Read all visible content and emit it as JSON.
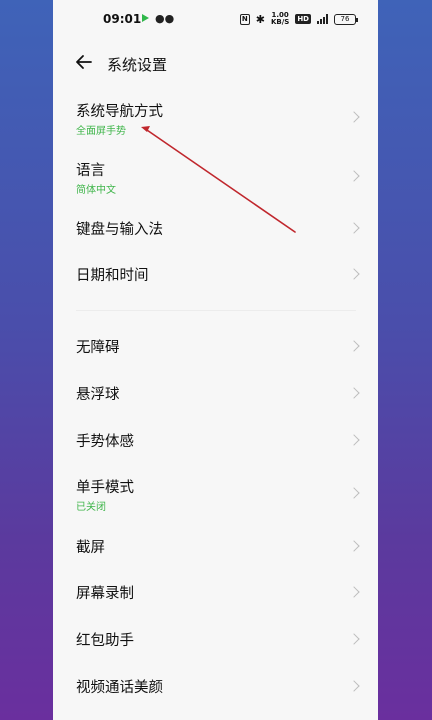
{
  "status_bar": {
    "time": "09:01",
    "speed_top": "1.00",
    "speed_bottom": "KB/S",
    "hd_label": "HD",
    "battery": "76"
  },
  "header": {
    "title": "系统设置"
  },
  "group1": [
    {
      "label": "系统导航方式",
      "sub": "全面屏手势"
    },
    {
      "label": "语言",
      "sub": "简体中文"
    },
    {
      "label": "键盘与输入法"
    },
    {
      "label": "日期和时间"
    }
  ],
  "group2": [
    {
      "label": "无障碍"
    },
    {
      "label": "悬浮球"
    },
    {
      "label": "手势体感"
    },
    {
      "label": "单手模式",
      "sub": "已关闭"
    },
    {
      "label": "截屏"
    },
    {
      "label": "屏幕录制"
    },
    {
      "label": "红包助手"
    },
    {
      "label": "视频通话美颜"
    }
  ],
  "colors": {
    "subtitle": "#3fb54a",
    "annotation": "#c0272d"
  }
}
